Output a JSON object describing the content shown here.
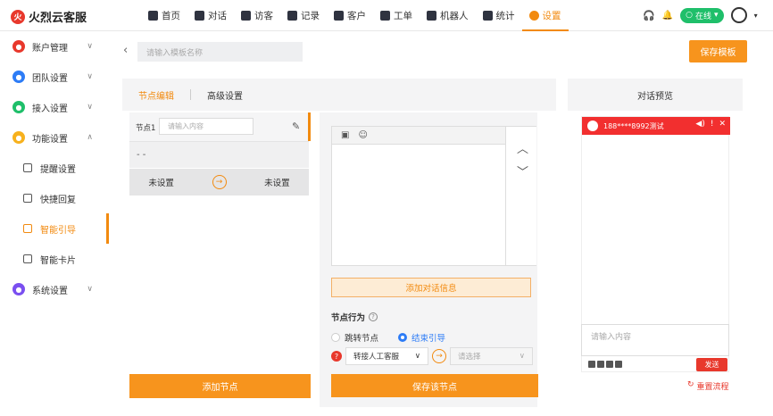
{
  "brand": {
    "logo_glyph": "火",
    "name": "火烈云客服",
    "accent": "#f28a0f",
    "red": "#e8382c"
  },
  "nav": [
    {
      "label": "首页",
      "icon": "home-icon"
    },
    {
      "label": "对话",
      "icon": "chat-icon"
    },
    {
      "label": "访客",
      "icon": "visitor-icon"
    },
    {
      "label": "记录",
      "icon": "record-icon"
    },
    {
      "label": "客户",
      "icon": "customer-icon"
    },
    {
      "label": "工单",
      "icon": "ticket-icon"
    },
    {
      "label": "机器人",
      "icon": "robot-icon"
    },
    {
      "label": "统计",
      "icon": "stats-icon"
    },
    {
      "label": "设置",
      "icon": "gear-icon",
      "active": true
    }
  ],
  "status": {
    "label": "在线",
    "color": "#1fbf6a"
  },
  "sidebar": {
    "items": [
      {
        "label": "账户管理",
        "color": "#e8382c",
        "chev": "∨"
      },
      {
        "label": "团队设置",
        "color": "#2d7cf6",
        "chev": "∨"
      },
      {
        "label": "接入设置",
        "color": "#1fbf6a",
        "chev": "∨"
      },
      {
        "label": "功能设置",
        "color": "#f7b11d",
        "chev": "∧"
      }
    ],
    "subs": [
      {
        "label": "提醒设置"
      },
      {
        "label": "快捷回复"
      },
      {
        "label": "智能引导",
        "active": true
      },
      {
        "label": "智能卡片"
      }
    ],
    "last": {
      "label": "系统设置",
      "color": "#7a4ff0",
      "chev": "∨"
    }
  },
  "toolbar": {
    "back": "‹",
    "name_placeholder": "请输入模板名称",
    "save_label": "保存模板"
  },
  "tabs": {
    "edit": "节点编辑",
    "advanced": "高级设置"
  },
  "preview": {
    "title": "对话预览"
  },
  "node": {
    "label": "节点1",
    "placeholder": "请输入内容",
    "dash": "- -",
    "left_cond": "未设置",
    "right_cond": "未设置",
    "add_label": "添加节点"
  },
  "editor": {
    "add_msg": "添加对话信息",
    "behavior": "节点行为",
    "radio_jump": "跳转节点",
    "radio_end": "结束引导",
    "select_a": "转接人工客服",
    "select_b": "请选择",
    "save_node": "保存该节点"
  },
  "phone": {
    "title": "188****8992测试",
    "input_placeholder": "请输入内容",
    "send": "发送",
    "reset": "重置流程"
  }
}
